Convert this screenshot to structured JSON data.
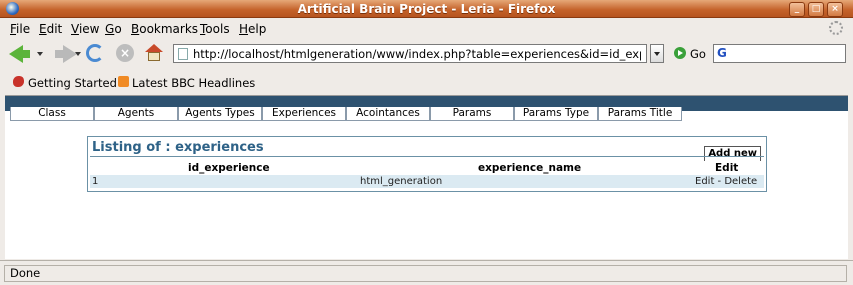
{
  "window": {
    "title": "Artificial Brain Project - Leria - Firefox"
  },
  "menu": [
    "File",
    "Edit",
    "View",
    "Go",
    "Bookmarks",
    "Tools",
    "Help"
  ],
  "menu_mnemonics": [
    "F",
    "E",
    "V",
    "G",
    "B",
    "T",
    "H"
  ],
  "menu_rest": [
    "ile",
    "dit",
    "iew",
    "o",
    "ookmarks",
    "ools",
    "elp"
  ],
  "nav": {
    "url": "http://localhost/htmlgeneration/www/index.php?table=experiences&id=id_experience",
    "go_label": "Go",
    "search_logo": "G"
  },
  "bookmarks": [
    {
      "label": "Getting Started",
      "icon": "firefox-red-icon"
    },
    {
      "label": "Latest BBC Headlines",
      "icon": "rss-feed-icon"
    }
  ],
  "tabs": [
    "Class",
    "Agents",
    "Agents Types",
    "Experiences",
    "Acointances",
    "Params",
    "Params Type",
    "Params Title"
  ],
  "listing": {
    "title": "Listing of : experiences",
    "add_new": "Add new",
    "columns": [
      "id_experience",
      "experience_name",
      "Edit"
    ],
    "rows": [
      {
        "id": "1",
        "name": "html_generation",
        "actions": "Edit - Delete"
      }
    ]
  },
  "status": {
    "text": "Done"
  },
  "colors": {
    "titlebar": "#c4622a",
    "band": "#2e5270",
    "panel_border": "#6b91a6",
    "row_bg": "#dbeaf2",
    "title_text": "#2e6287"
  }
}
